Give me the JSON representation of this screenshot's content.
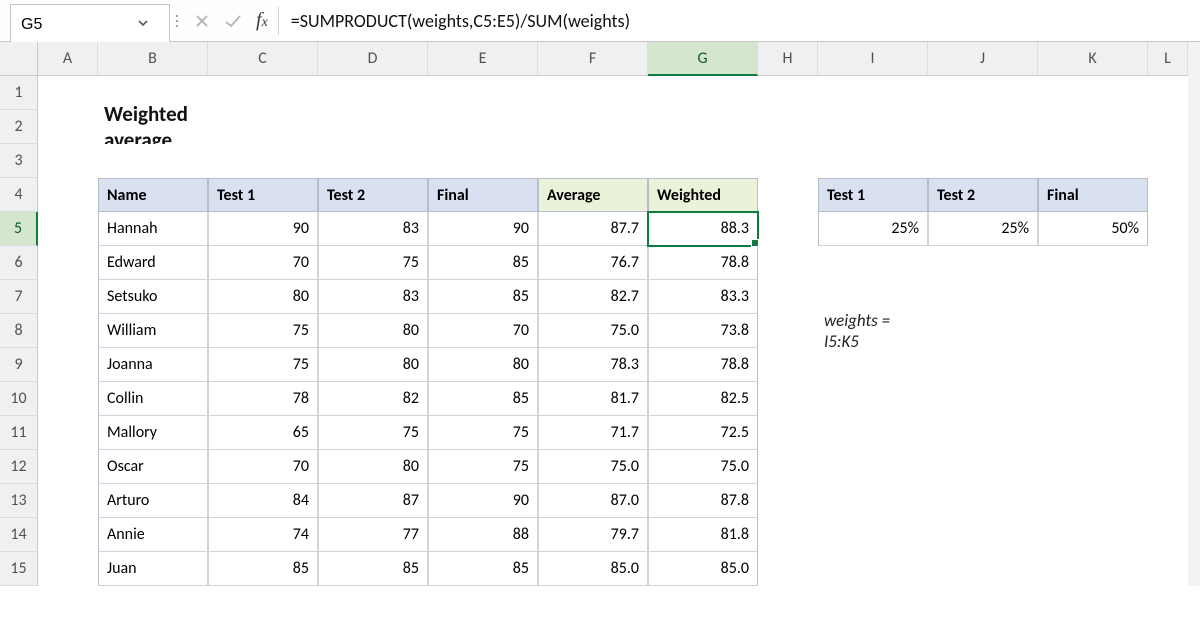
{
  "active_cell": "G5",
  "formula_bar": {
    "formula": "=SUMPRODUCT(weights,C5:E5)/SUM(weights)"
  },
  "column_headers": [
    "A",
    "B",
    "C",
    "D",
    "E",
    "F",
    "G",
    "H",
    "I",
    "J",
    "K",
    "L"
  ],
  "row_headers": [
    "1",
    "2",
    "3",
    "4",
    "5",
    "6",
    "7",
    "8",
    "9",
    "10",
    "11",
    "12",
    "13",
    "14",
    "15"
  ],
  "title": "Weighted average",
  "main_table": {
    "headers": [
      "Name",
      "Test 1",
      "Test 2",
      "Final",
      "Average",
      "Weighted"
    ],
    "rows": [
      {
        "name": "Hannah",
        "t1": "90",
        "t2": "83",
        "final": "90",
        "avg": "87.7",
        "w": "88.3"
      },
      {
        "name": "Edward",
        "t1": "70",
        "t2": "75",
        "final": "85",
        "avg": "76.7",
        "w": "78.8"
      },
      {
        "name": "Setsuko",
        "t1": "80",
        "t2": "83",
        "final": "85",
        "avg": "82.7",
        "w": "83.3"
      },
      {
        "name": "William",
        "t1": "75",
        "t2": "80",
        "final": "70",
        "avg": "75.0",
        "w": "73.8"
      },
      {
        "name": "Joanna",
        "t1": "75",
        "t2": "80",
        "final": "80",
        "avg": "78.3",
        "w": "78.8"
      },
      {
        "name": "Collin",
        "t1": "78",
        "t2": "82",
        "final": "85",
        "avg": "81.7",
        "w": "82.5"
      },
      {
        "name": "Mallory",
        "t1": "65",
        "t2": "75",
        "final": "75",
        "avg": "71.7",
        "w": "72.5"
      },
      {
        "name": "Oscar",
        "t1": "70",
        "t2": "80",
        "final": "75",
        "avg": "75.0",
        "w": "75.0"
      },
      {
        "name": "Arturo",
        "t1": "84",
        "t2": "87",
        "final": "90",
        "avg": "87.0",
        "w": "87.8"
      },
      {
        "name": "Annie",
        "t1": "74",
        "t2": "77",
        "final": "88",
        "avg": "79.7",
        "w": "81.8"
      },
      {
        "name": "Juan",
        "t1": "85",
        "t2": "85",
        "final": "85",
        "avg": "85.0",
        "w": "85.0"
      }
    ]
  },
  "weights_table": {
    "headers": [
      "Test 1",
      "Test 2",
      "Final"
    ],
    "values": [
      "25%",
      "25%",
      "50%"
    ]
  },
  "note": "weights = I5:K5",
  "chart_data": {
    "type": "table",
    "title": "Weighted average",
    "main_columns": [
      "Name",
      "Test 1",
      "Test 2",
      "Final",
      "Average",
      "Weighted"
    ],
    "main_rows": [
      [
        "Hannah",
        90,
        83,
        90,
        87.7,
        88.3
      ],
      [
        "Edward",
        70,
        75,
        85,
        76.7,
        78.8
      ],
      [
        "Setsuko",
        80,
        83,
        85,
        82.7,
        83.3
      ],
      [
        "William",
        75,
        80,
        70,
        75.0,
        73.8
      ],
      [
        "Joanna",
        75,
        80,
        80,
        78.3,
        78.8
      ],
      [
        "Collin",
        78,
        82,
        85,
        81.7,
        82.5
      ],
      [
        "Mallory",
        65,
        75,
        75,
        71.7,
        72.5
      ],
      [
        "Oscar",
        70,
        80,
        75,
        75.0,
        75.0
      ],
      [
        "Arturo",
        84,
        87,
        90,
        87.0,
        87.8
      ],
      [
        "Annie",
        74,
        77,
        88,
        79.7,
        81.8
      ],
      [
        "Juan",
        85,
        85,
        85,
        85.0,
        85.0
      ]
    ],
    "weights_columns": [
      "Test 1",
      "Test 2",
      "Final"
    ],
    "weights_values": [
      0.25,
      0.25,
      0.5
    ],
    "formula": "=SUMPRODUCT(weights,C5:E5)/SUM(weights)"
  }
}
